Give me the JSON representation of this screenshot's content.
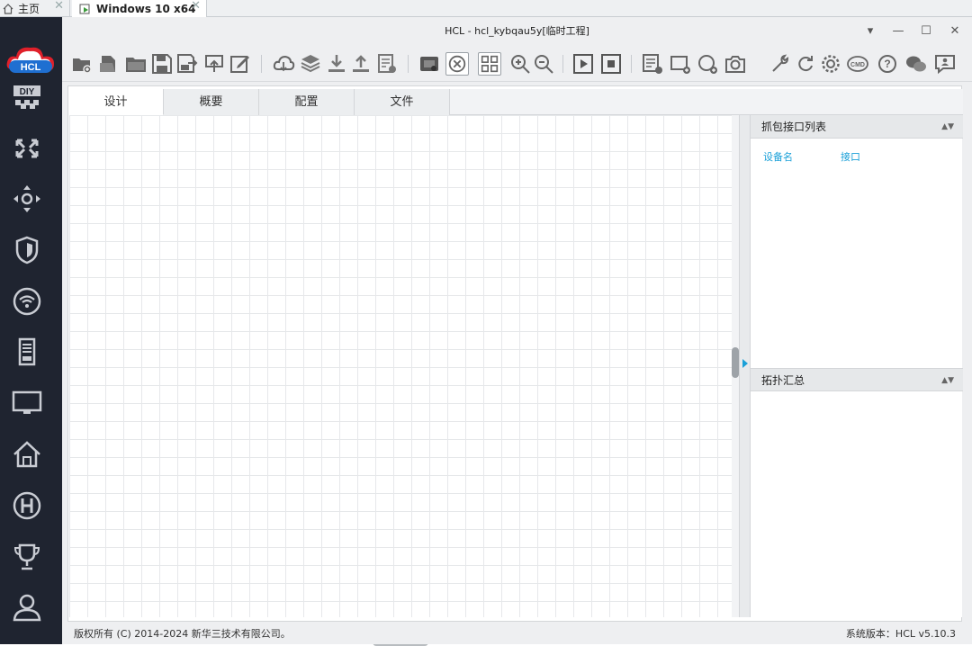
{
  "vm_tabs": {
    "home": "主页",
    "windows": "Windows 10 x64"
  },
  "app": {
    "title": "HCL - hcl_kybqau5y[临时工程]",
    "logo_text": "HCL"
  },
  "window_controls": [
    "▾",
    "—",
    "☐",
    "✕"
  ],
  "sidebar": {
    "items": [
      "diy-icon",
      "switch-icon",
      "router-icon",
      "firewall-icon",
      "wireless-icon",
      "server-icon",
      "terminal-icon",
      "home-icon",
      "h-logo-icon",
      "trophy-icon",
      "user-icon"
    ]
  },
  "toolbar": {
    "icons": [
      "new-project-icon",
      "open-project-icon",
      "open-folder-icon",
      "save-icon",
      "save-as-icon",
      "export-icon",
      "edit-icon",
      "cloud-icon",
      "layers-icon",
      "download-icon",
      "upload-icon",
      "log-icon",
      "screenshot-device-icon",
      "topology-icon",
      "grid-icon",
      "zoom-in-icon",
      "zoom-out-icon",
      "start-icon",
      "stop-icon",
      "add-list-icon",
      "add-rect-icon",
      "add-circle-icon",
      "camera-icon",
      "wrench-icon",
      "refresh-icon",
      "settings-icon",
      "cmd-icon",
      "help-icon",
      "wechat-icon",
      "feedback-icon"
    ]
  },
  "tabs": {
    "design": "设计",
    "overview": "概要",
    "config": "配置",
    "files": "文件"
  },
  "capture_panel": {
    "title": "抓包接口列表",
    "col_device": "设备名",
    "col_interface": "接口"
  },
  "topology_panel": {
    "title": "拓扑汇总"
  },
  "status": {
    "copyright": "版权所有 (C) 2014-2024 新华三技术有限公司。",
    "version": "系统版本：HCL v5.10.3"
  },
  "colors": {
    "sidebar_bg": "#1f2430",
    "accent": "#1aa0d8"
  }
}
